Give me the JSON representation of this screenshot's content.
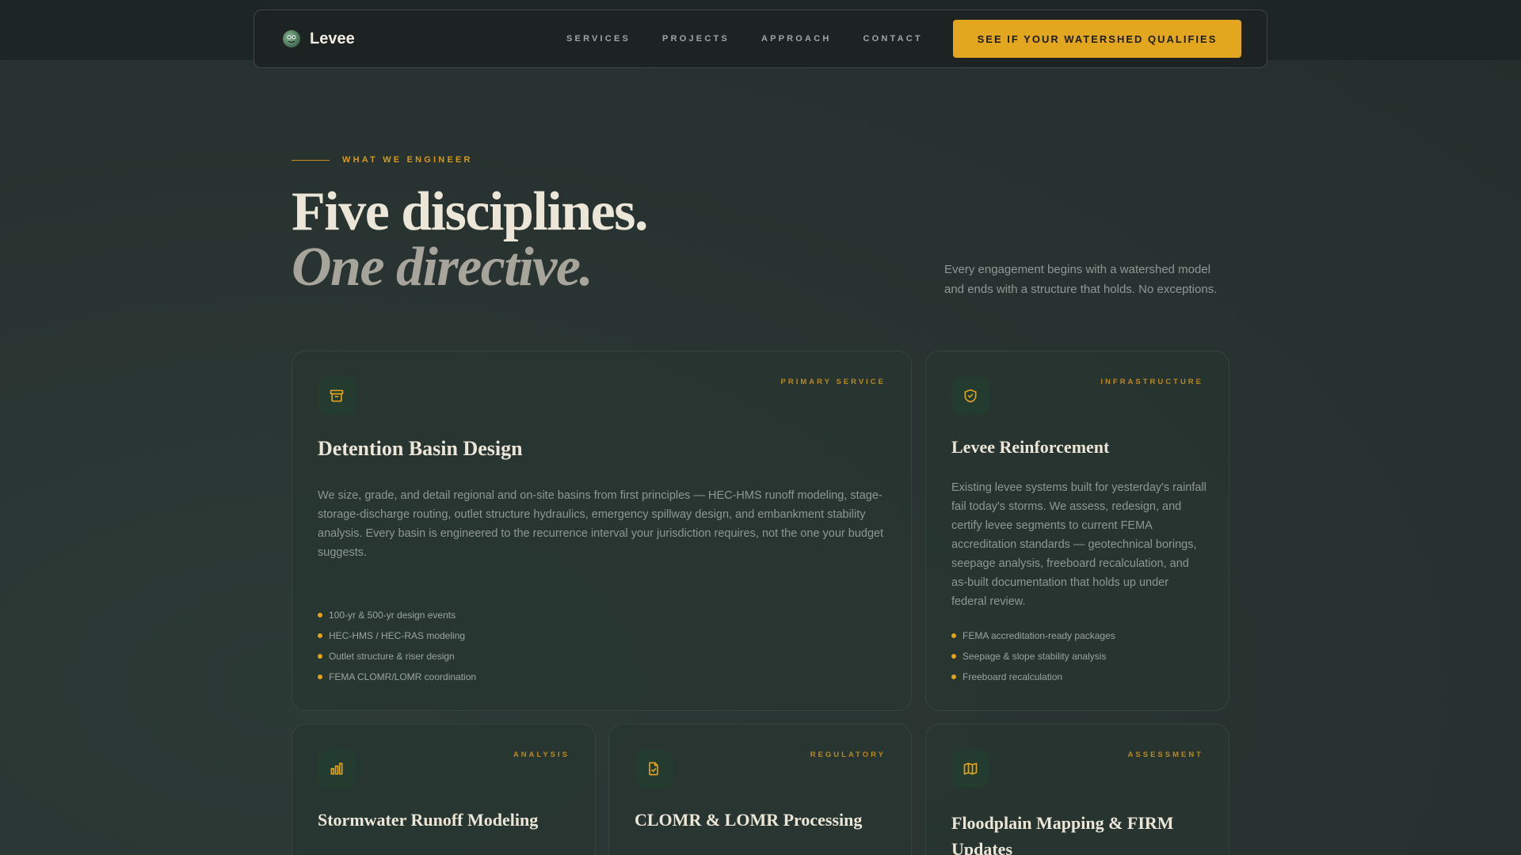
{
  "nav": {
    "brand": "Levee",
    "links": [
      "SERVICES",
      "PROJECTS",
      "APPROACH",
      "CONTACT"
    ],
    "cta": "SEE IF YOUR WATERSHED QUALIFIES"
  },
  "section": {
    "eyebrow": "WHAT WE ENGINEER",
    "title_line1": "Five disciplines.",
    "title_line2": "One directive.",
    "intro": "Every engagement begins with a watershed model and ends with a structure that holds. No exceptions."
  },
  "cards": [
    {
      "tag": "PRIMARY SERVICE",
      "icon": "archive-icon",
      "title": "Detention Basin Design",
      "description": "We size, grade, and detail regional and on-site basins from first principles — HEC-HMS runoff modeling, stage-storage-discharge routing, outlet structure hydraulics, emergency spillway design, and embankment stability analysis. Every basin is engineered to the recurrence interval your jurisdiction requires, not the one your budget suggests.",
      "bullets": [
        "100-yr & 500-yr design events",
        "HEC-HMS / HEC-RAS modeling",
        "Outlet structure & riser design",
        "FEMA CLOMR/LOMR coordination"
      ]
    },
    {
      "tag": "INFRASTRUCTURE",
      "icon": "shield-check-icon",
      "title": "Levee Reinforcement",
      "description": "Existing levee systems built for yesterday's rainfall fail today's storms. We assess, redesign, and certify levee segments to current FEMA accreditation standards — geotechnical borings, seepage analysis, freeboard recalculation, and as-built documentation that holds up under federal review.",
      "bullets": [
        "FEMA accreditation-ready packages",
        "Seepage & slope stability analysis",
        "Freeboard recalculation"
      ]
    },
    {
      "tag": "ANALYSIS",
      "icon": "bar-chart-icon",
      "title": "Stormwater Runoff Modeling"
    },
    {
      "tag": "REGULATORY",
      "icon": "file-check-icon",
      "title": "CLOMR & LOMR Processing"
    },
    {
      "tag": "ASSESSMENT",
      "icon": "map-icon",
      "title": "Floodplain Mapping & FIRM Updates"
    }
  ],
  "colors": {
    "accent": "#e3a71f",
    "background": "#2a3331",
    "card_border": "#36443f",
    "heading": "#ece6d8"
  }
}
